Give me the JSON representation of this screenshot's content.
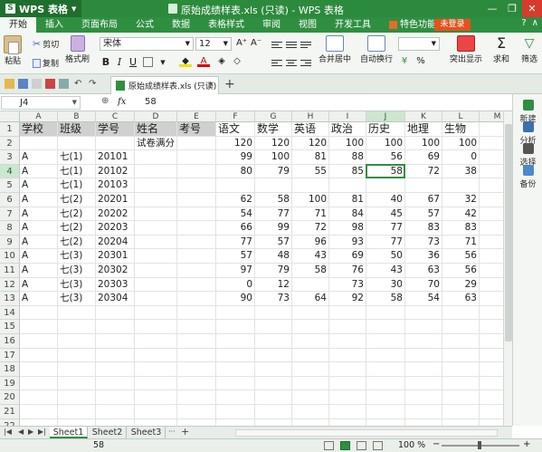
{
  "titlebar": {
    "app_name": "WPS 表格",
    "doc_title": "原始成绩样表.xls (只读) - WPS 表格",
    "minimize": "—",
    "maximize": "❐",
    "close": "✕"
  },
  "menu": {
    "tabs": [
      "开始",
      "插入",
      "页面布局",
      "公式",
      "数据",
      "表格样式",
      "审阅",
      "视图",
      "开发工具"
    ],
    "special_tab": "特色功能",
    "login": "未登录"
  },
  "ribbon": {
    "paste": "粘贴",
    "cut": "剪切",
    "copy": "复制",
    "format_painter": "格式刷",
    "font_name": "宋体",
    "font_size": "12",
    "merge_center": "合并居中",
    "wrap_text": "自动换行",
    "highlight": "突出显示",
    "sum": "求和",
    "filter": "筛选",
    "bold": "B",
    "italic": "I",
    "underline": "U"
  },
  "doc_tab": {
    "label": "原始成绩样表.xls (只读)",
    "close": "×",
    "add": "+"
  },
  "formula_bar": {
    "cell_ref": "J4",
    "fx": "fx",
    "value": "58"
  },
  "columns": [
    "A",
    "B",
    "C",
    "D",
    "E",
    "F",
    "G",
    "H",
    "I",
    "J",
    "K",
    "L",
    "M"
  ],
  "rows": [
    [
      "学校",
      "班级",
      "学号",
      "姓名",
      "考号",
      "语文",
      "数学",
      "英语",
      "政治",
      "历史",
      "地理",
      "生物"
    ],
    [
      "",
      "",
      "",
      "试卷满分",
      "",
      "120",
      "120",
      "120",
      "100",
      "100",
      "100",
      "100"
    ],
    [
      "A",
      "七(1)",
      "20101",
      "",
      "",
      "99",
      "100",
      "81",
      "88",
      "56",
      "69",
      "0"
    ],
    [
      "A",
      "七(1)",
      "20102",
      "",
      "",
      "80",
      "79",
      "55",
      "85",
      "58",
      "72",
      "38"
    ],
    [
      "A",
      "七(1)",
      "20103",
      "",
      "",
      "",
      "",
      "",
      "",
      "",
      "",
      ""
    ],
    [
      "A",
      "七(2)",
      "20201",
      "",
      "",
      "62",
      "58",
      "100",
      "81",
      "40",
      "67",
      "32"
    ],
    [
      "A",
      "七(2)",
      "20202",
      "",
      "",
      "54",
      "77",
      "71",
      "84",
      "45",
      "57",
      "42"
    ],
    [
      "A",
      "七(2)",
      "20203",
      "",
      "",
      "66",
      "99",
      "72",
      "98",
      "77",
      "83",
      "83"
    ],
    [
      "A",
      "七(2)",
      "20204",
      "",
      "",
      "77",
      "57",
      "96",
      "93",
      "77",
      "73",
      "71"
    ],
    [
      "A",
      "七(3)",
      "20301",
      "",
      "",
      "57",
      "48",
      "43",
      "69",
      "50",
      "36",
      "56"
    ],
    [
      "A",
      "七(3)",
      "20302",
      "",
      "",
      "97",
      "79",
      "58",
      "76",
      "43",
      "63",
      "56"
    ],
    [
      "A",
      "七(3)",
      "20303",
      "",
      "",
      "0",
      "12",
      "",
      "73",
      "30",
      "70",
      "29"
    ],
    [
      "A",
      "七(3)",
      "20304",
      "",
      "",
      "90",
      "73",
      "64",
      "92",
      "58",
      "54",
      "63"
    ]
  ],
  "row_numbers": [
    "1",
    "2",
    "3",
    "4",
    "5",
    "6",
    "7",
    "8",
    "9",
    "10",
    "11",
    "12",
    "13",
    "14",
    "15",
    "16",
    "17",
    "18",
    "19",
    "20",
    "21",
    "22"
  ],
  "selection": {
    "row": "4",
    "col": "J"
  },
  "sidepanel": [
    "新建",
    "分析",
    "选择",
    "备份"
  ],
  "sheets": [
    "Sheet1",
    "Sheet2",
    "Sheet3"
  ],
  "sheet_controls": {
    "more": "···",
    "add": "+"
  },
  "status": {
    "value": "58",
    "zoom": "100 %",
    "zoom_minus": "−",
    "zoom_plus": "+"
  },
  "colors": {
    "brand_green": "#2c8a3c",
    "selection_green": "#2f8f41",
    "header_shade": "#d0d0d0",
    "close_red": "#d63b2c",
    "login_orange": "#e8501e"
  }
}
